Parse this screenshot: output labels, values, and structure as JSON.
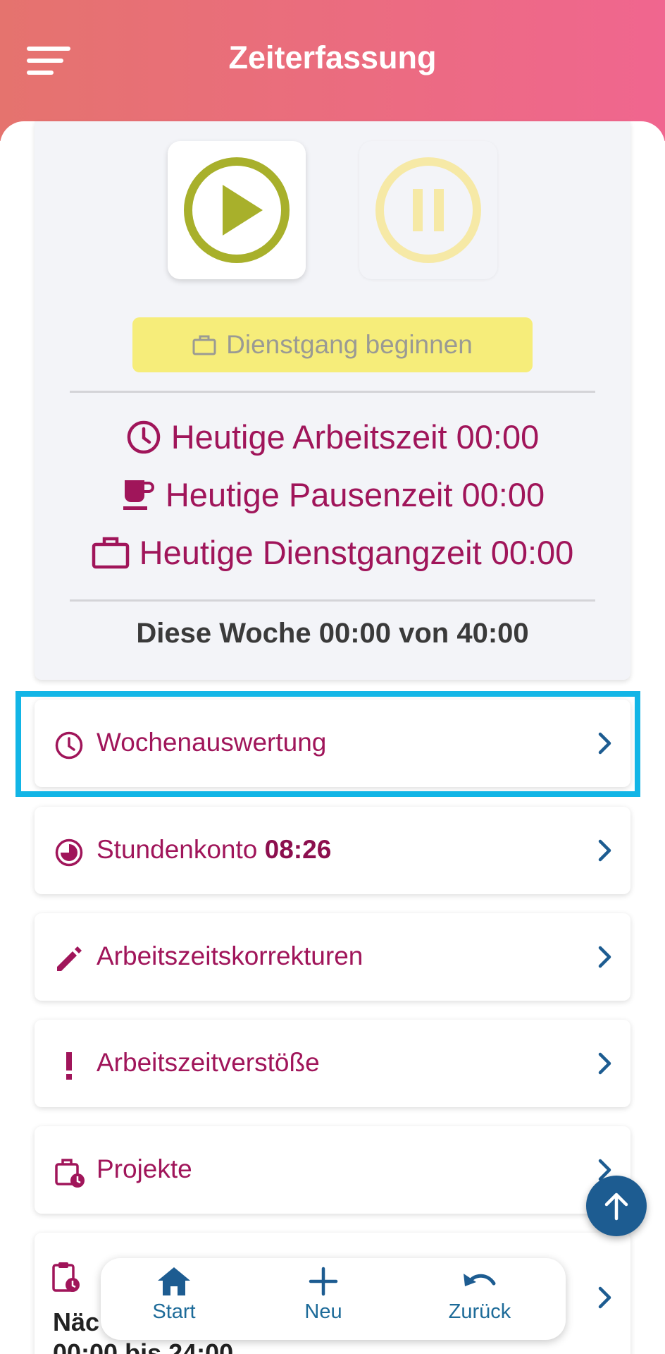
{
  "appbar": {
    "title": "Zeiterfassung",
    "menu_icon": "hamburger-menu-icon"
  },
  "tracker": {
    "play_icon": "play-icon",
    "pause_icon": "pause-icon",
    "errand_button": "Dienstgang beginnen",
    "stats": {
      "work": "Heutige Arbeitszeit 00:00",
      "break": "Heutige Pausenzeit 00:00",
      "errand": "Heutige Dienstgangzeit 00:00"
    },
    "week_total": "Diese Woche 00:00 von 40:00"
  },
  "menu": {
    "weekly_report": "Wochenauswertung",
    "hours_account_label": "Stundenkonto",
    "hours_account_value": "08:26",
    "corrections": "Arbeitszeitskorrekturen",
    "violations": "Arbeitszeitverstöße",
    "projects": "Projekte"
  },
  "peek_card": {
    "line1": "Näc",
    "line2": "00:00 bis 24:00"
  },
  "bottom_nav": {
    "start": "Start",
    "new": "Neu",
    "back": "Zurück"
  },
  "colors": {
    "accent": "#a0155a",
    "play": "#a8b02b",
    "pause": "#f6e9a6",
    "errand": "#f6ed7a",
    "nav": "#1d5c91",
    "highlight": "#12b5e6"
  }
}
